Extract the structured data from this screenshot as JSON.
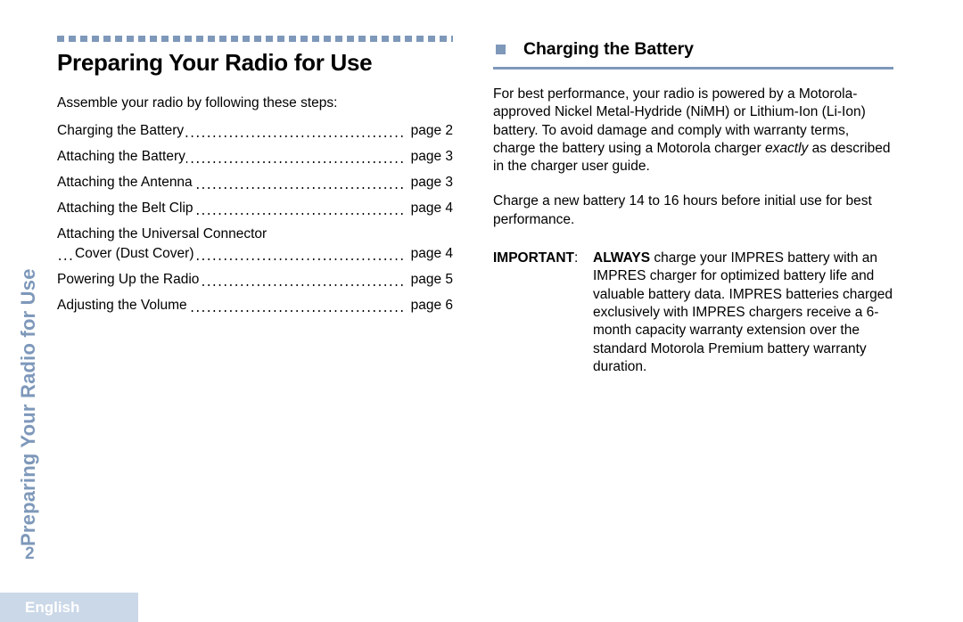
{
  "side_tab": {
    "label": "Preparing Your Radio for Use",
    "color": "#7e98ba"
  },
  "footer": {
    "page_number": "2",
    "language": "English",
    "bar_color": "#cbd8e8"
  },
  "left_column": {
    "chapter_title": "Preparing Your Radio for Use",
    "intro": "Assemble your radio by following these steps:",
    "toc": [
      {
        "text": "Charging the Battery",
        "page": "page 2",
        "indent": false,
        "dots": true,
        "wrap_head": false
      },
      {
        "text": "Attaching the Battery",
        "page": "page 3",
        "indent": false,
        "dots": true,
        "wrap_head": false
      },
      {
        "text": "Attaching the Antenna",
        "page": "page 3",
        "indent": false,
        "dots": true,
        "wrap_head": false
      },
      {
        "text": "Attaching the Belt Clip",
        "page": "page 4",
        "indent": false,
        "dots": true,
        "wrap_head": false
      },
      {
        "text": "Attaching the Universal Connector",
        "page": "",
        "indent": false,
        "dots": false,
        "wrap_head": true
      },
      {
        "text": "Cover (Dust Cover)",
        "page": "page 4",
        "indent": true,
        "dots": true,
        "wrap_head": false
      },
      {
        "text": "Powering Up the Radio",
        "page": "page 5",
        "indent": false,
        "dots": true,
        "wrap_head": false
      },
      {
        "text": "Adjusting the Volume",
        "page": "page 6",
        "indent": false,
        "dots": true,
        "wrap_head": false
      }
    ]
  },
  "right_column": {
    "section_title": "Charging the Battery",
    "bullet_color": "#7e98ba",
    "rule_color": "#7e98ba",
    "paragraph_1_part_1": "For best performance, your radio is powered by a Motorola-approved Nickel Metal-Hydride (NiMH) or Lithium-Ion (Li-Ion) battery. To avoid damage and comply with warranty terms, charge the battery using a Motorola charger ",
    "paragraph_1_emphasis": "exactly",
    "paragraph_1_part_2": " as described in the charger user guide.",
    "paragraph_2": "Charge a new battery 14 to 16 hours before initial use for best performance.",
    "important_label": "IMPORTANT",
    "important_colon": ":",
    "important_bold_lead": "ALWAYS",
    "important_body": " charge your IMPRES battery with an IMPRES charger for optimized battery life and valuable battery data. IMPRES batteries charged exclusively with IMPRES chargers receive a 6-month capacity warranty extension over the standard Motorola Premium battery warranty duration."
  }
}
